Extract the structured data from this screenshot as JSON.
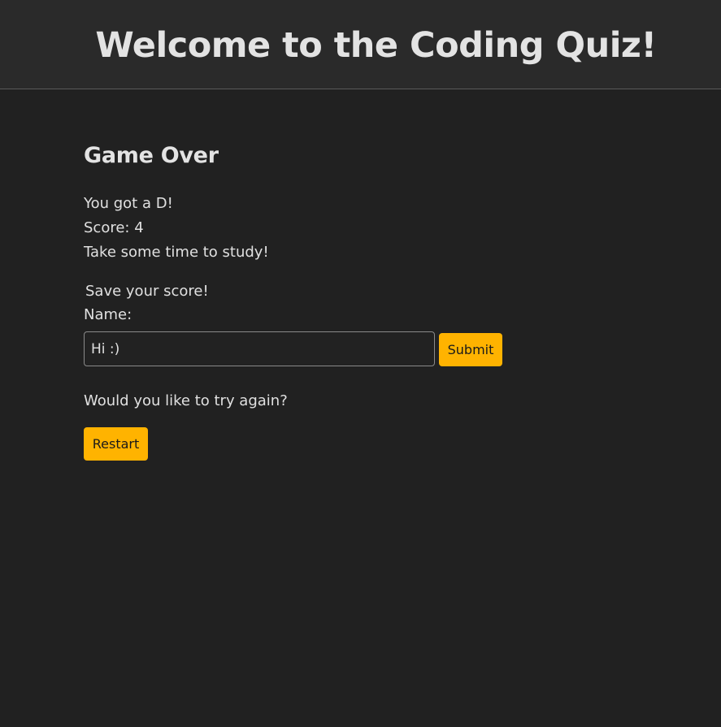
{
  "header": {
    "title": "Welcome to the Coding Quiz!"
  },
  "result": {
    "heading": "Game Over",
    "grade_text": "You got a D!",
    "score_text": "Score: 4",
    "advice_text": "Take some time to study!"
  },
  "save_form": {
    "prompt": "Save your score!",
    "name_label": "Name:",
    "name_value": "Hi :)",
    "submit_label": "Submit"
  },
  "retry": {
    "question": "Would you like to try again?",
    "restart_label": "Restart"
  },
  "colors": {
    "background": "#212121",
    "header_background": "#2a2a2a",
    "accent": "#ffb300",
    "text": "#e0e0e0"
  }
}
